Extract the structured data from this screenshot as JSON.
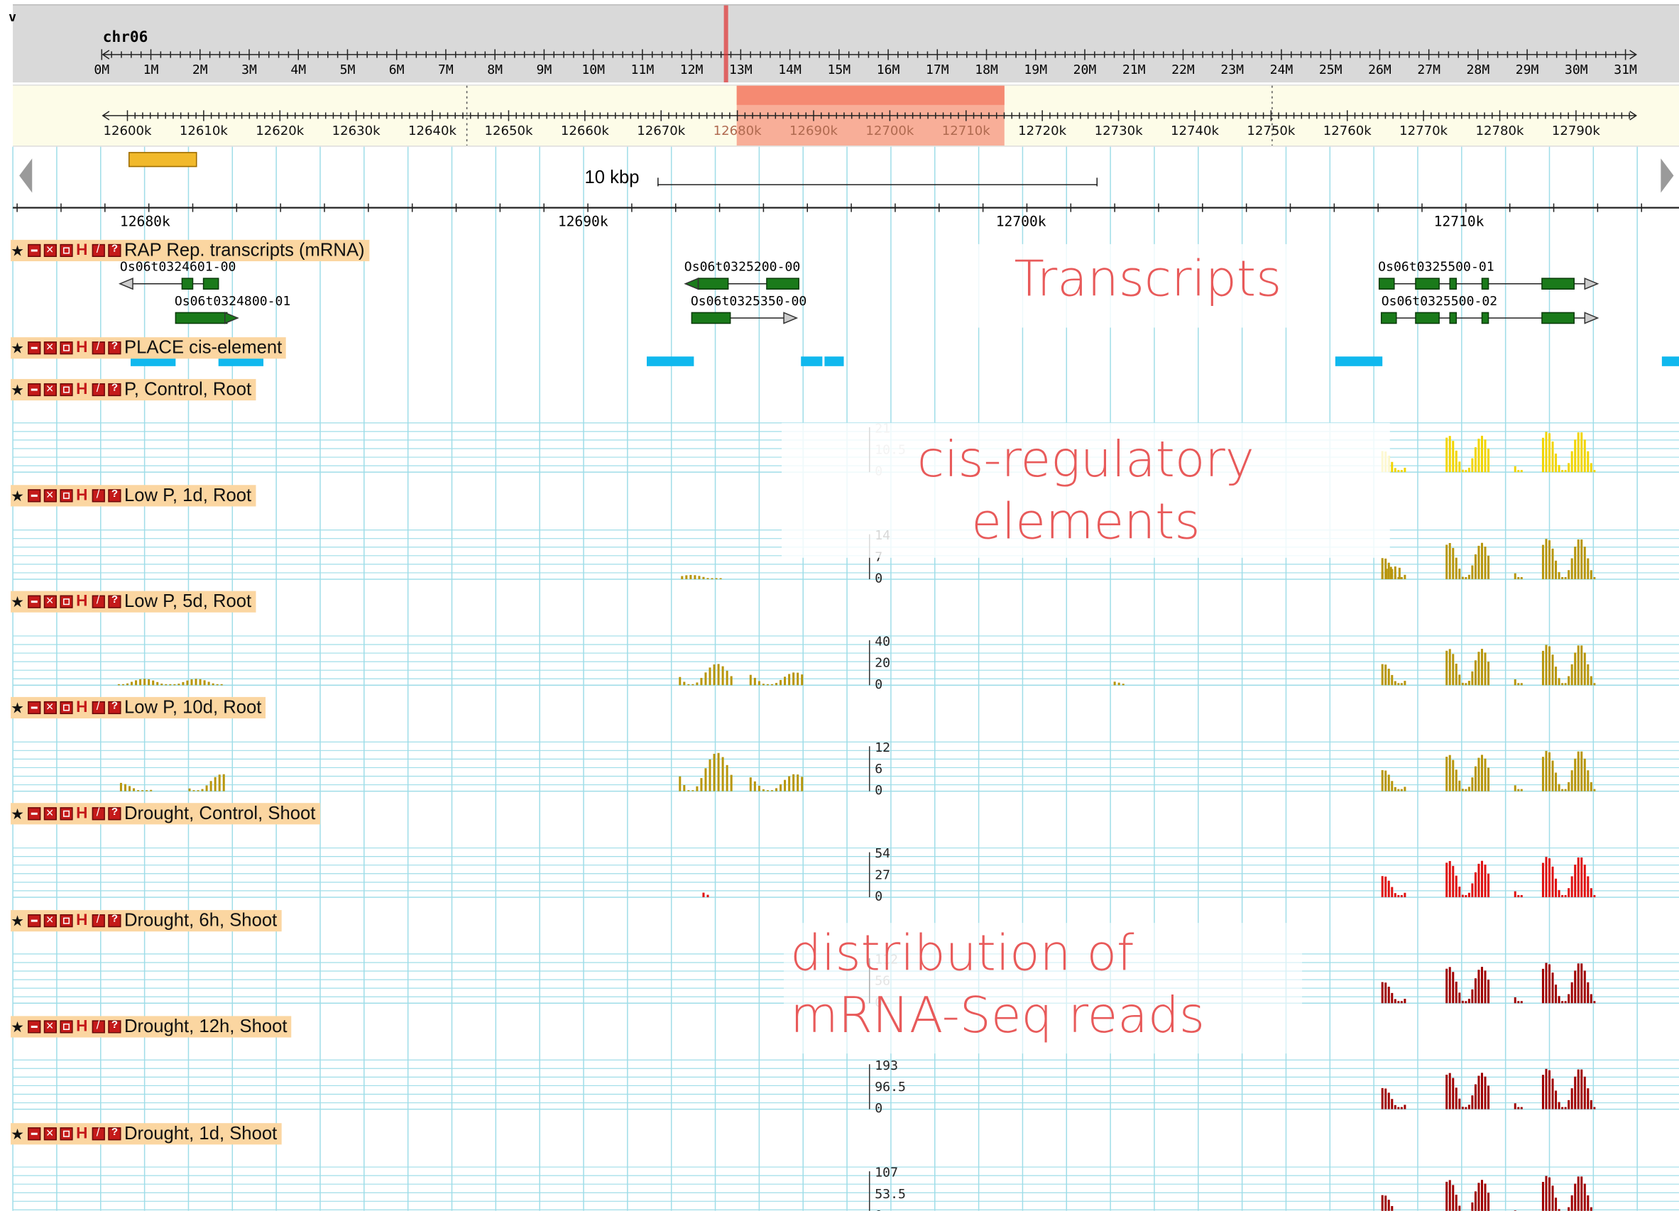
{
  "chromosome": {
    "name": "chr06",
    "ticks": [
      "0M",
      "1M",
      "2M",
      "3M",
      "4M",
      "5M",
      "6M",
      "7M",
      "8M",
      "9M",
      "10M",
      "11M",
      "12M",
      "13M",
      "14M",
      "15M",
      "16M",
      "17M",
      "18M",
      "19M",
      "20M",
      "21M",
      "22M",
      "23M",
      "24M",
      "25M",
      "26M",
      "27M",
      "28M",
      "29M",
      "30M",
      "31M"
    ]
  },
  "region": {
    "ticks": [
      "12600k",
      "12610k",
      "12620k",
      "12630k",
      "12640k",
      "12650k",
      "12660k",
      "12670k",
      "12680k",
      "12690k",
      "12700k",
      "12710k",
      "12720k",
      "12730k",
      "12740k",
      "12750k",
      "12760k",
      "12770k",
      "12780k",
      "12790k"
    ]
  },
  "scale_bar": {
    "label": "10 kbp"
  },
  "detail_ruler": {
    "ticks": [
      "12680k",
      "12690k",
      "12700k",
      "12710k"
    ]
  },
  "tracks": [
    {
      "label": "RAP Rep. transcripts (mRNA)"
    },
    {
      "label": "PLACE cis-element"
    },
    {
      "label": "P, Control, Root",
      "scale": [
        "21",
        "10.5",
        "0"
      ],
      "color": "#f2d500"
    },
    {
      "label": "Low P, 1d, Root",
      "scale": [
        "14",
        "7",
        "0"
      ],
      "color": "#b8960c"
    },
    {
      "label": "Low P, 5d, Root",
      "scale": [
        "40",
        "20",
        "0"
      ],
      "color": "#b8960c"
    },
    {
      "label": "Low P, 10d, Root",
      "scale": [
        "12",
        "6",
        "0"
      ],
      "color": "#b8960c"
    },
    {
      "label": "Drought, Control, Shoot",
      "scale": [
        "54",
        "27",
        "0"
      ],
      "color": "#e01010"
    },
    {
      "label": "Drought, 6h, Shoot",
      "scale": [
        "112",
        "56",
        "0"
      ],
      "color": "#a00000"
    },
    {
      "label": "Drought, 12h, Shoot",
      "scale": [
        "193",
        "96.5",
        "0"
      ],
      "color": "#a00000"
    },
    {
      "label": "Drought, 1d, Shoot",
      "scale": [
        "107",
        "53.5",
        "0"
      ],
      "color": "#a00000"
    }
  ],
  "transcripts": {
    "t1": "Os06t0324601-00",
    "t2": "Os06t0324800-01",
    "t3": "Os06t0325200-00",
    "t4": "Os06t0325350-00",
    "t5": "Os06t0325500-01",
    "t6": "Os06t0325500-02"
  },
  "overlays": {
    "transcripts": "Transcripts",
    "cis_line1": "cis-regulatory",
    "cis_line2": "elements",
    "dist_line1": "distribution of",
    "dist_line2": "mRNA-Seq reads"
  },
  "colors": {
    "grid": "#9fdde8",
    "cis_element": "#10b8ee",
    "exon": "#1a7a1a",
    "selection": "#f7a08a"
  },
  "icons": [
    "star-icon",
    "collapse-icon",
    "close-icon",
    "feature-list-icon",
    "histogram-icon",
    "edit-icon",
    "help-icon",
    "scroll-left-icon",
    "scroll-right-icon"
  ]
}
